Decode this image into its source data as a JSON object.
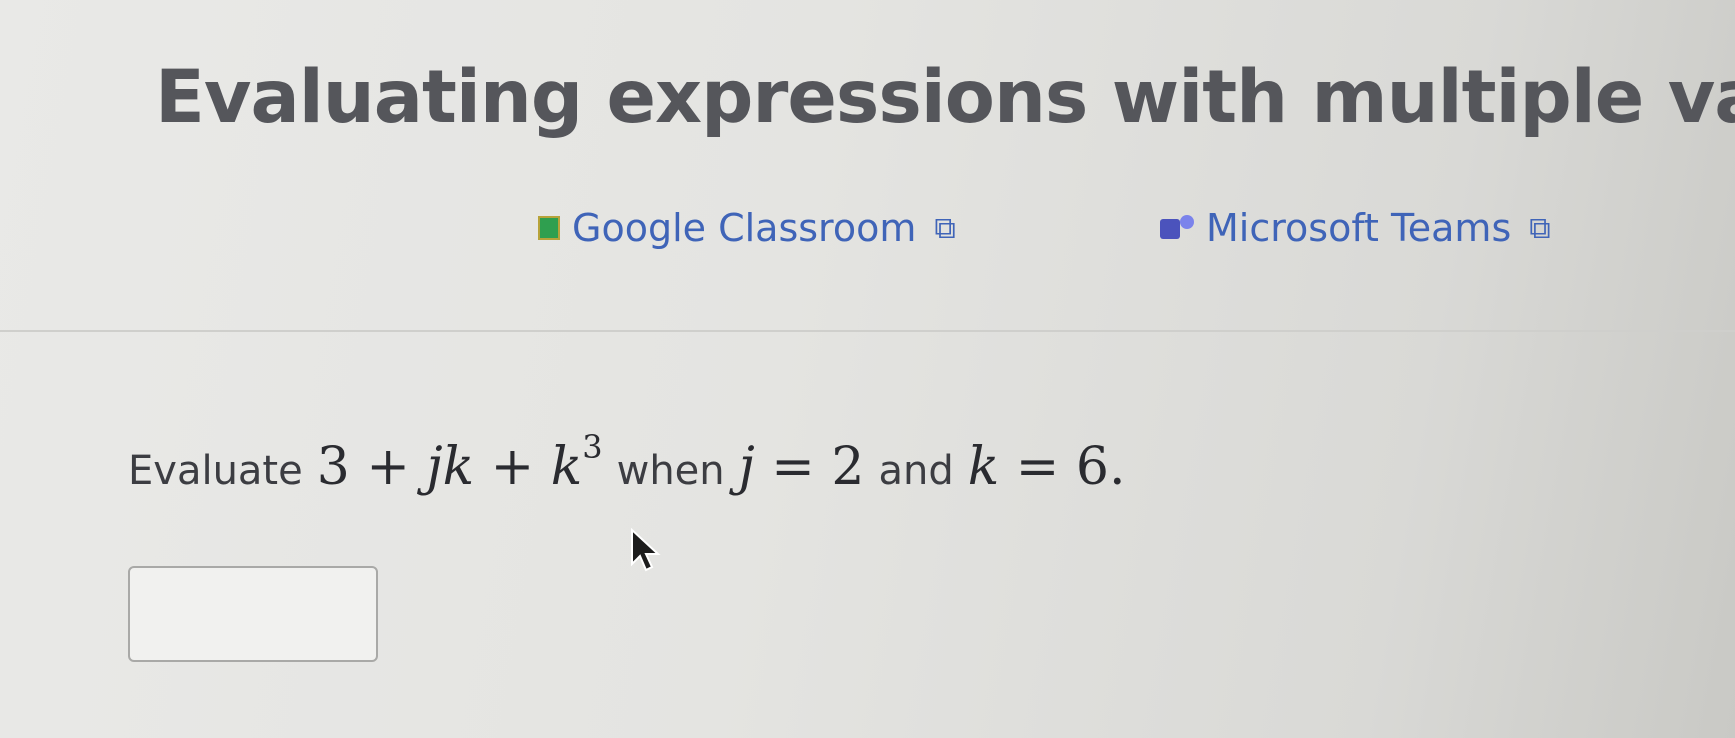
{
  "header": {
    "title": "Evaluating expressions with multiple varia"
  },
  "share": {
    "google": {
      "label": "Google Classroom",
      "icon": "google-classroom-icon",
      "ext_icon": "external-link-icon"
    },
    "teams": {
      "label": "Microsoft Teams",
      "icon": "microsoft-teams-icon",
      "ext_icon": "external-link-icon"
    },
    "link_color": "#3f64b8"
  },
  "question": {
    "prefix": "Evaluate",
    "expression": {
      "a": "3 + ",
      "b": "jk",
      "c": " + ",
      "d": "k",
      "exp": "3"
    },
    "when": "when",
    "cond1": {
      "var": "j",
      "rest": " = 2"
    },
    "and": "and",
    "cond2": {
      "var": "k",
      "rest": " = 6."
    }
  },
  "answer": {
    "value": ""
  }
}
